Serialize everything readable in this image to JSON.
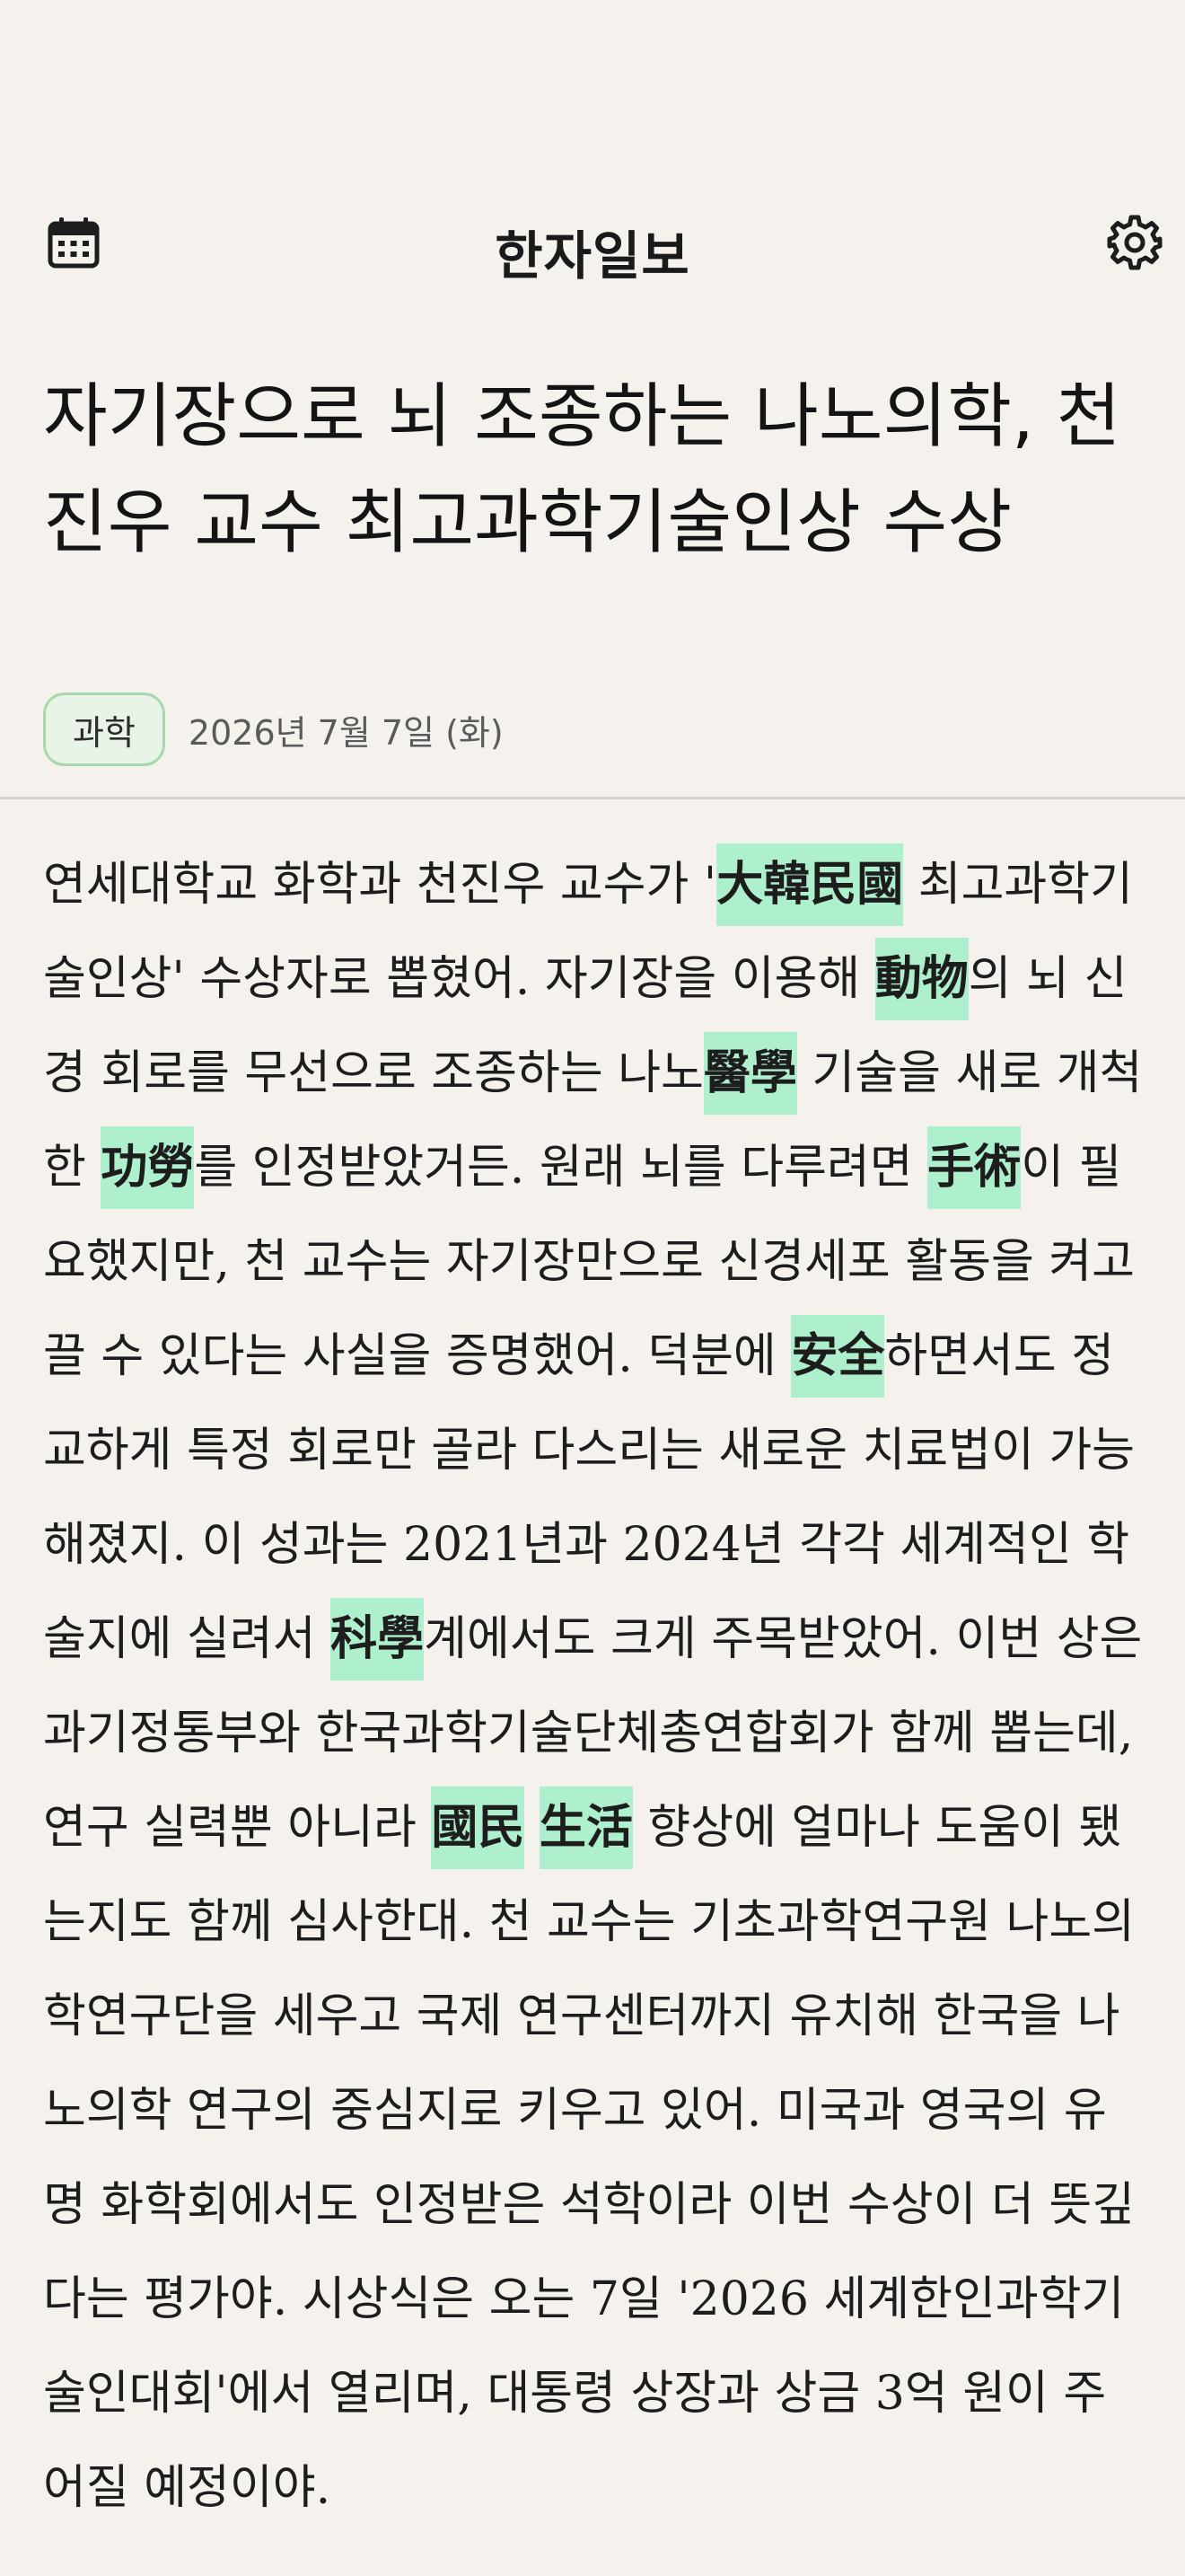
{
  "header": {
    "title": "한자일보",
    "calendar_icon": "calendar-icon",
    "settings_icon": "gear-icon"
  },
  "article": {
    "headline": "자기장으로 뇌 조종하는 나노의학, 천진우 교수 최고과학기술인상 수상",
    "category": "과학",
    "date": "2026년 7월 7일 (화)",
    "body_segments": [
      {
        "text": "연세대학교 화학과 천진우 교수가 '"
      },
      {
        "text": "大韓民國",
        "hanja": true
      },
      {
        "text": " 최고과학기술인상' 수상자로 뽑혔어. 자기장을 이용해 "
      },
      {
        "text": "動物",
        "hanja": true
      },
      {
        "text": "의 뇌 신경 회로를 무선으로 조종하는 나노"
      },
      {
        "text": "醫學",
        "hanja": true
      },
      {
        "text": " 기술을 새로 개척한 "
      },
      {
        "text": "功勞",
        "hanja": true
      },
      {
        "text": "를 인정받았거든. 원래 뇌를 다루려면 "
      },
      {
        "text": "手術",
        "hanja": true
      },
      {
        "text": "이 필요했지만, 천 교수는 자기장만으로 신경세포 활동을 켜고 끌 수 있다는 사실을 증명했어. 덕분에 "
      },
      {
        "text": "安全",
        "hanja": true
      },
      {
        "text": "하면서도 정교하게 특정 회로만 골라 다스리는 새로운 치료법이 가능해졌지. 이 성과는 2021년과 2024년 각각 세계적인 학술지에 실려서 "
      },
      {
        "text": "科學",
        "hanja": true
      },
      {
        "text": "계에서도 크게 주목받았어. 이번 상은 과기정통부와 한국과학기술단체총연합회가 함께 뽑는데, 연구 실력뿐 아니라 "
      },
      {
        "text": "國民",
        "hanja": true
      },
      {
        "text": " "
      },
      {
        "text": "生活",
        "hanja": true
      },
      {
        "text": " 향상에 얼마나 도움이 됐는지도 함께 심사한대. 천 교수는 기초과학연구원 나노의학연구단을 세우고 국제 연구센터까지 유치해 한국을 나노의학 연구의 중심지로 키우고 있어. 미국과 영국의 유명 화학회에서도 인정받은 석학이라 이번 수상이 더 뜻깊다는 평가야. 시상식은 오는 7일 '2026 세계한인과학기술인대회'에서 열리며, 대통령 상장과 상금 3억 원이 주어질 예정이야."
      }
    ]
  },
  "colors": {
    "background": "#f5f2ee",
    "hanja_highlight": "#aef0cd",
    "badge_border": "#a9d8ae",
    "badge_bg": "#e8f4e7"
  }
}
